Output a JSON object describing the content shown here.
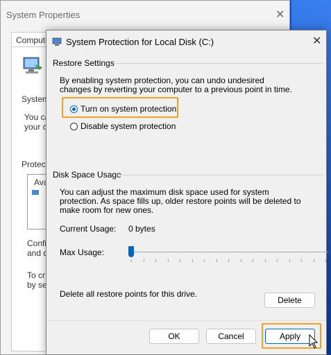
{
  "back_window": {
    "title": "System Properties",
    "tab": "Compute",
    "section_system": "System",
    "text_you_ca": "You ca",
    "text_your_co": "your co",
    "section_protection": "Protecti",
    "list_item": "Ava",
    "text_config": "Config",
    "text_and": "and de",
    "text_to_cr": "To cr",
    "text_by_se": "by se"
  },
  "dialog": {
    "title": "System Protection for Local Disk (C:)",
    "restore": {
      "heading": "Restore Settings",
      "desc": "By enabling system protection, you can undo undesired changes by reverting your computer to a previous point in time.",
      "option_on": "Turn on system protection",
      "option_off": "Disable system protection",
      "selected": "on"
    },
    "disk": {
      "heading": "Disk Space Usage",
      "desc": "You can adjust the maximum disk space used for system protection. As space fills up, older restore points will be deleted to make room for new ones.",
      "current_label": "Current Usage:",
      "current_value": "0 bytes",
      "max_label": "Max Usage:",
      "max_value_fraction": 0.0
    },
    "delete_text": "Delete all restore points for this drive.",
    "delete_button": "Delete",
    "ok_button": "OK",
    "cancel_button": "Cancel",
    "apply_button": "Apply"
  },
  "colors": {
    "accent": "#0067c0",
    "highlight": "#f4a020"
  }
}
